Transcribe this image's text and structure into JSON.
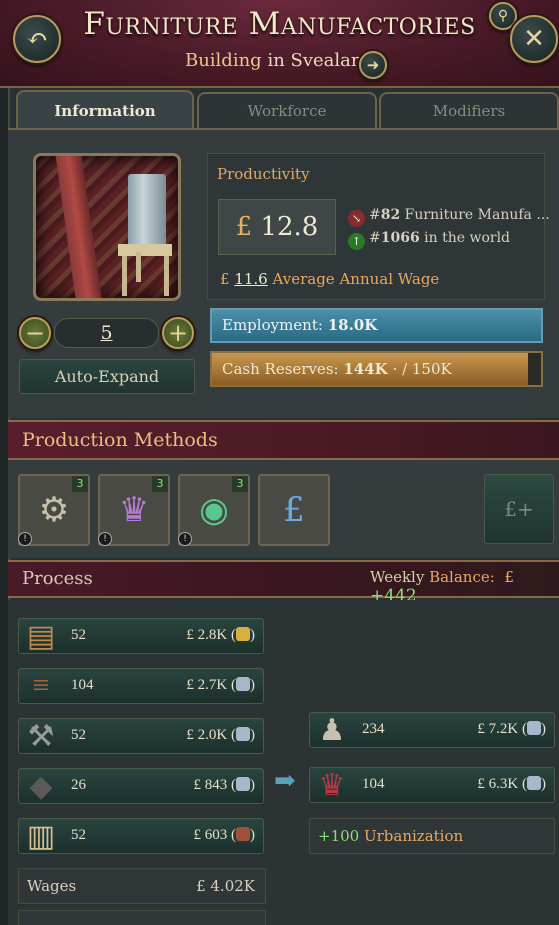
{
  "header": {
    "title": "Furniture Manufactories",
    "subtitle_prefix": "Building",
    "subtitle_in": "in",
    "subtitle_location": "Svealand",
    "icons": {
      "back": "back-arrow-icon",
      "close": "close-icon",
      "search": "search-icon",
      "goto": "arrow-right-icon"
    }
  },
  "tabs": [
    {
      "label": "Information",
      "active": true
    },
    {
      "label": "Workforce",
      "active": false
    },
    {
      "label": "Modifiers",
      "active": false
    }
  ],
  "building": {
    "level": "5",
    "auto_expand_label": "Auto-Expand"
  },
  "productivity": {
    "label": "Productivity",
    "currency": "£",
    "value": "12.8",
    "rank1_hash": "#",
    "rank1_num": "82",
    "rank1_text": "Furniture Manufa ...",
    "rank2_hash": "#",
    "rank2_num": "1066",
    "rank2_text": "in the world",
    "wage_value": "11.6",
    "wage_label": "Average Annual Wage"
  },
  "employment": {
    "label": "Employment:",
    "value": "18.0K"
  },
  "cash": {
    "label": "Cash Reserves:",
    "value": "144K",
    "sep": "·",
    "max": "/ 150K",
    "fill_fraction": 0.96
  },
  "production_methods": {
    "label": "Production Methods",
    "items": [
      {
        "name": "lathe-icon",
        "badge": "3",
        "warn": "!"
      },
      {
        "name": "armchair-icon",
        "badge": "3",
        "warn": "!"
      },
      {
        "name": "furnace-icon",
        "badge": "3",
        "warn": "!"
      },
      {
        "name": "pound-hand-icon",
        "badge": "",
        "warn": ""
      }
    ],
    "add_label": "£+"
  },
  "process": {
    "label": "Process",
    "balance_prefix": "Weekly",
    "balance_label": "Balance:",
    "balance_currency": "£",
    "balance_value": "+442",
    "inputs": [
      {
        "icon": "planks-icon",
        "amount": "52",
        "value": "£ 2.8K (",
        "coin": "gold"
      },
      {
        "icon": "logs-icon",
        "amount": "104",
        "value": "£ 2.7K (",
        "coin": "silver"
      },
      {
        "icon": "tools-icon",
        "amount": "52",
        "value": "£ 2.0K (",
        "coin": "silver"
      },
      {
        "icon": "coal-icon",
        "amount": "26",
        "value": "£ 843 (",
        "coin": "silver"
      },
      {
        "icon": "fabric-icon",
        "amount": "52",
        "value": "£ 603 (",
        "coin": "copper"
      }
    ],
    "outputs": [
      {
        "icon": "chair-icon",
        "amount": "234",
        "value": "£ 7.2K (",
        "coin": "silver"
      },
      {
        "icon": "luxury-chair-icon",
        "amount": "104",
        "value": "£ 6.3K (",
        "coin": "silver"
      }
    ],
    "coin_close": ")",
    "urbanization_value": "+100",
    "urbanization_label": "Urbanization",
    "wages_label": "Wages",
    "wages_value": "£ 4.02K"
  },
  "colors": {
    "accent": "#e8a860",
    "positive": "#8ae07a",
    "employment": "#3a84a0",
    "cash": "#b0803c"
  }
}
